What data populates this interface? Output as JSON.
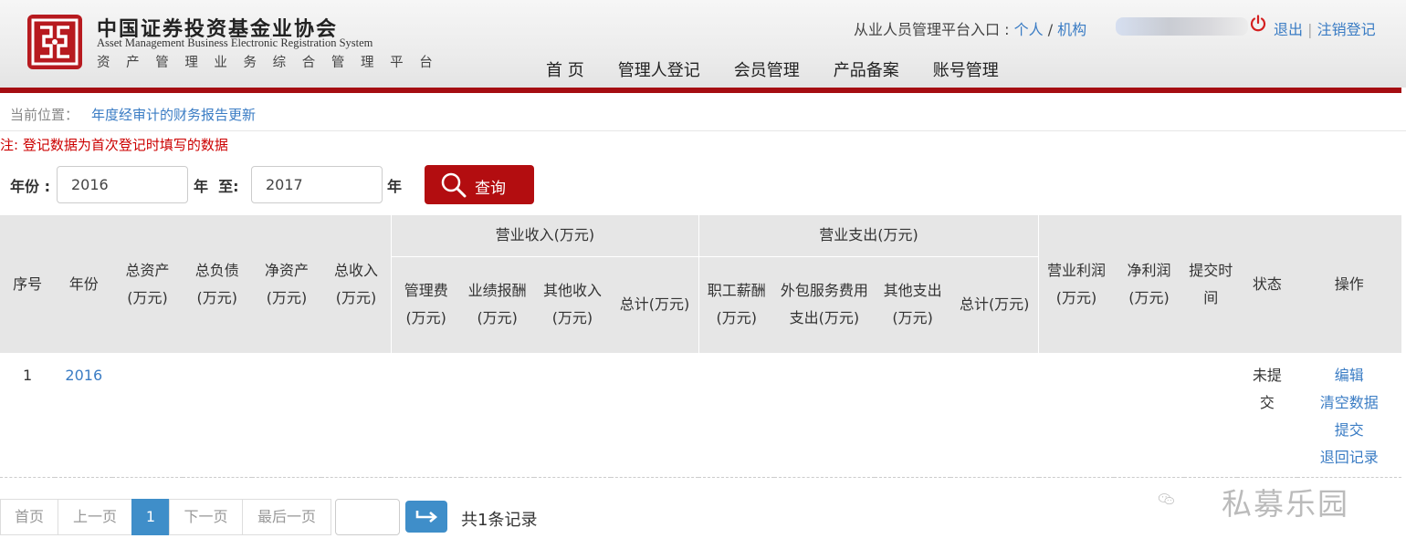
{
  "header": {
    "org_name_cn": "中国证券投资基金业协会",
    "org_name_en": "Asset Management Business Electronic Registration System",
    "org_subtitle": "资 产 管 理 业 务 综 合 管 理 平 台",
    "portal_label": "从业人员管理平台入口 :",
    "portal_personal": "个人",
    "portal_sep": "/",
    "portal_org": "机构",
    "logout": "退出",
    "link_sep": "|",
    "deregister": "注销登记",
    "power_icon": "power-icon"
  },
  "nav": [
    "首 页",
    "管理人登记",
    "会员管理",
    "产品备案",
    "账号管理"
  ],
  "breadcrumb": {
    "label": "当前位置：",
    "current": "年度经审计的财务报告更新"
  },
  "note": "注: 登记数据为首次登记时填写的数据",
  "search": {
    "year_label": "年份 :",
    "from_value": "2016",
    "to_label": "年  至:",
    "to_value": "2017",
    "suffix": "年",
    "button": "查询"
  },
  "table": {
    "headers": {
      "seq": "序号",
      "year": "年份",
      "total_assets": "总资产(万元)",
      "total_liab": "总负债(万元)",
      "net_assets": "净资产(万元)",
      "total_income": "总收入(万元)",
      "op_income_group": "营业收入(万元)",
      "mgmt_fee": "管理费(万元)",
      "perf_fee": "业绩报酬(万元)",
      "other_income": "其他收入(万元)",
      "income_total": "总计(万元)",
      "op_expense_group": "营业支出(万元)",
      "salary": "职工薪酬(万元)",
      "outsourcing": "外包服务费用支出(万元)",
      "other_expense": "其他支出(万元)",
      "expense_total": "总计(万元)",
      "op_profit": "营业利润(万元)",
      "net_profit": "净利润(万元)",
      "submit_time": "提交时间",
      "status": "状态",
      "actions": "操作"
    },
    "rows": [
      {
        "seq": "1",
        "year": "2016",
        "status": "未提交",
        "actions": [
          "编辑",
          "清空数据",
          "提交",
          "退回记录"
        ]
      }
    ]
  },
  "pagination": {
    "first": "首页",
    "prev": "上一页",
    "current": "1",
    "next": "下一页",
    "last": "最后一页",
    "total": "共1条记录"
  },
  "watermark": "私募乐园",
  "colors": {
    "brand_red": "#a50d12",
    "button_red": "#b30d10",
    "link_blue": "#3a7cc4",
    "active_blue": "#3f8ec9",
    "note_red": "#cc0000"
  }
}
